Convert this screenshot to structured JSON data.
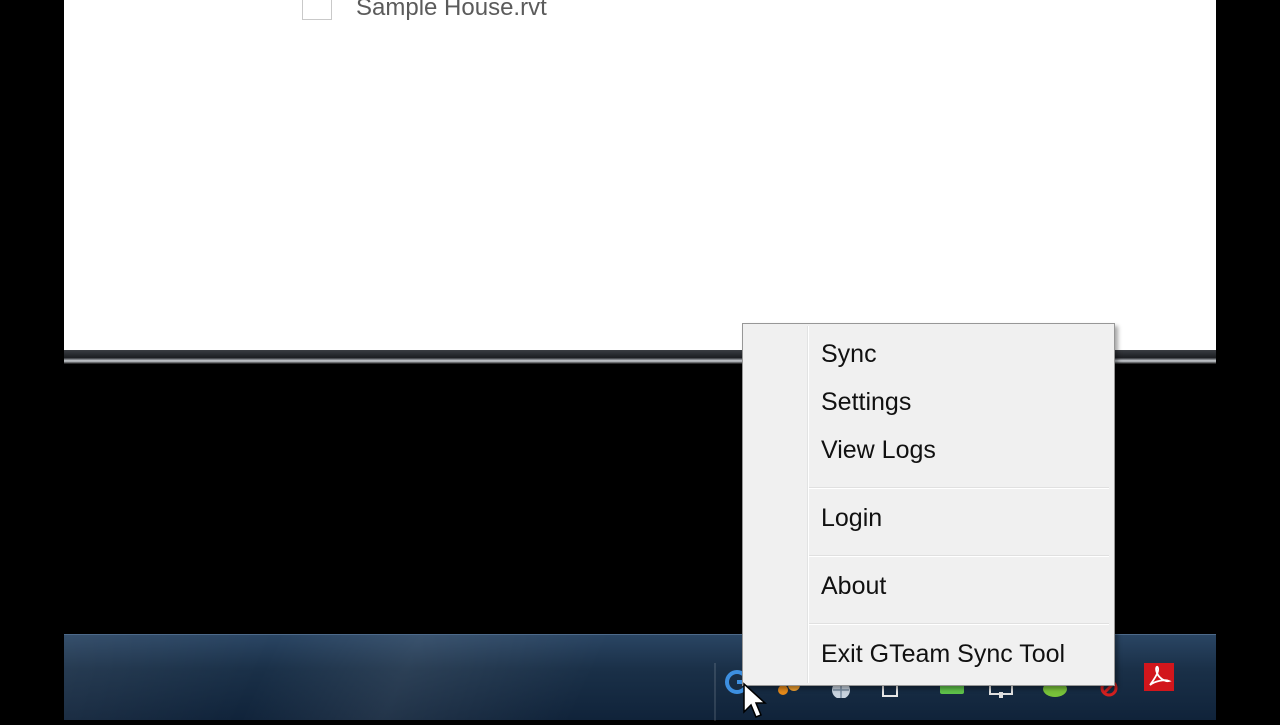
{
  "window": {
    "file_item": {
      "label": "Sample House.rvt",
      "checked": false
    }
  },
  "context_menu": {
    "items": [
      {
        "label": "Sync"
      },
      {
        "label": "Settings"
      },
      {
        "label": "View Logs"
      },
      {
        "label": "Login"
      },
      {
        "label": "About"
      },
      {
        "label": "Exit GTeam Sync Tool"
      }
    ]
  },
  "taskbar": {
    "tray_icons": [
      "gteam-sync-icon",
      "orange-app-icon",
      "globe-icon",
      "printer-icon",
      "battery-icon",
      "network-icon",
      "chat-icon",
      "volume-muted-icon",
      "pdf-icon"
    ]
  },
  "colors": {
    "menu_bg": "#f0f0f0",
    "menu_border": "#979797",
    "taskbar": "#1a3048",
    "pdf_red": "#d2161c"
  }
}
